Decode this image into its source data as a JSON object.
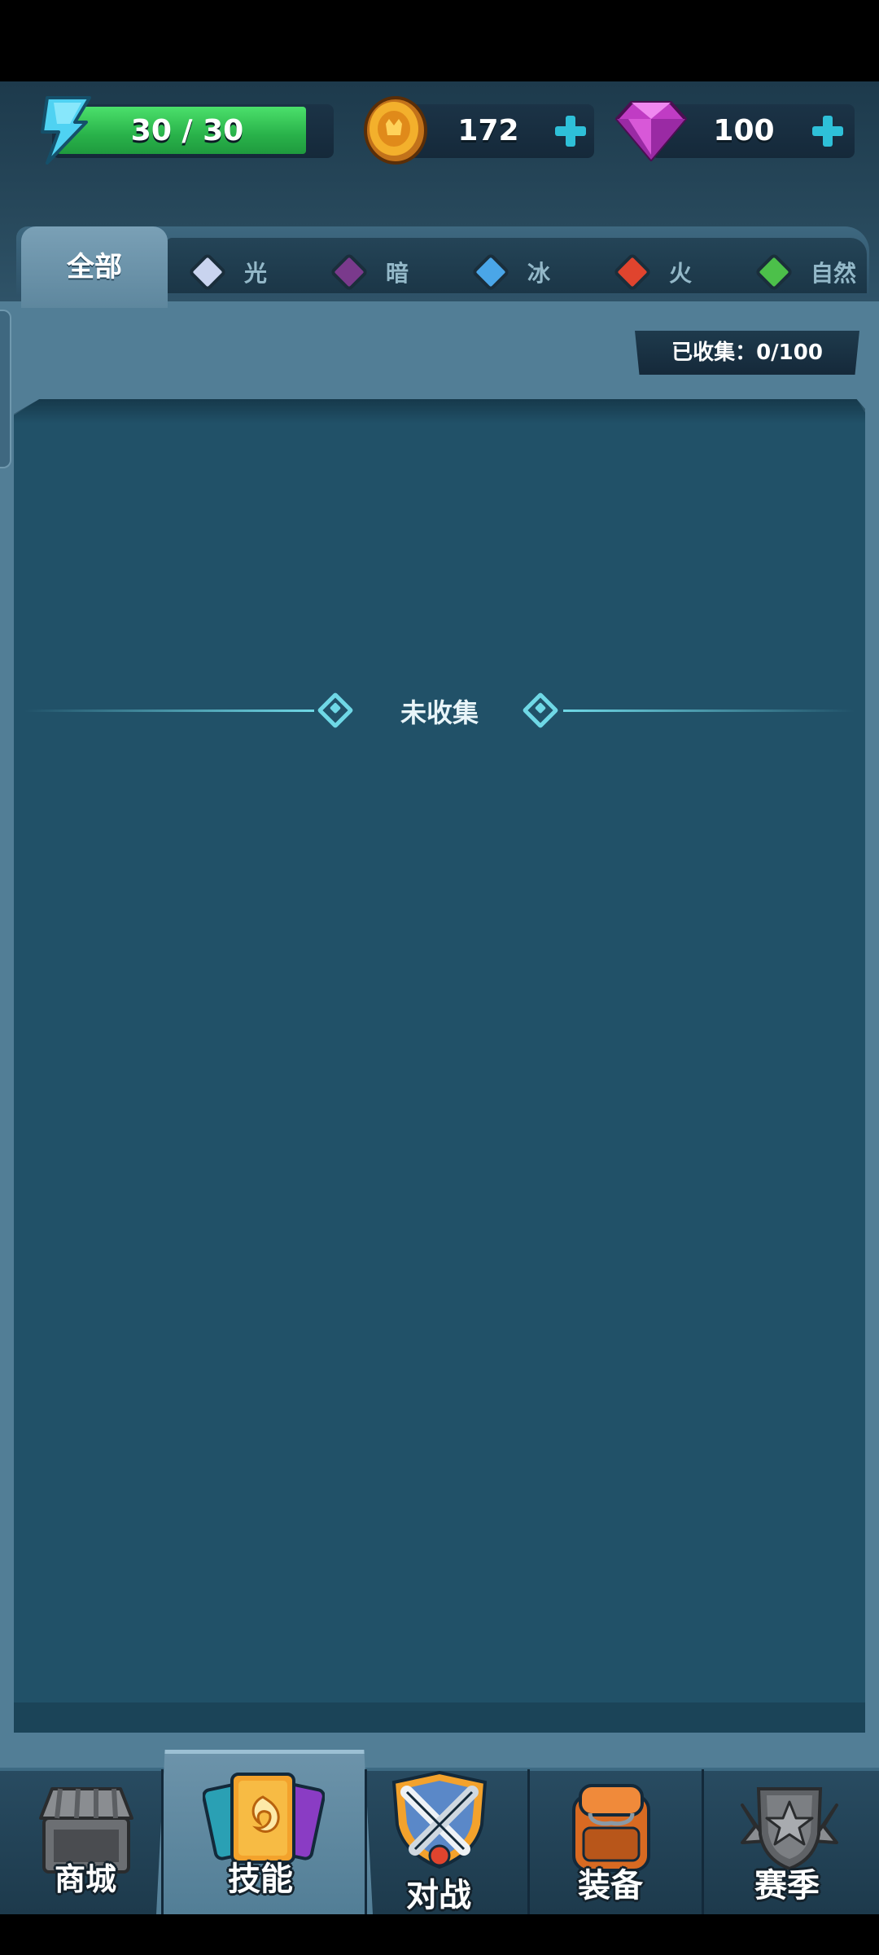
{
  "resources": {
    "energy": {
      "value": "30 / 30",
      "current": 30,
      "max": 30,
      "icon": "lightning-icon"
    },
    "coins": {
      "value": "172",
      "icon": "gold-coin-icon"
    },
    "gems": {
      "value": "100",
      "icon": "pink-gem-icon"
    }
  },
  "tabs": [
    {
      "label": "全部",
      "active": true
    },
    {
      "label": "光",
      "icon": "light-element-icon",
      "color": "#c9d4ef"
    },
    {
      "label": "暗",
      "icon": "dark-element-icon",
      "color": "#7a3a8c"
    },
    {
      "label": "冰",
      "icon": "ice-element-icon",
      "color": "#4aa6e8"
    },
    {
      "label": "火",
      "icon": "fire-element-icon",
      "color": "#e0442e"
    },
    {
      "label": "自然",
      "icon": "nature-element-icon",
      "color": "#4cc04a"
    }
  ],
  "collection": {
    "counter": "已收集：0/100",
    "section_label": "未收集"
  },
  "bottom_nav": [
    {
      "label": "商城",
      "icon": "shop-icon",
      "active": false
    },
    {
      "label": "技能",
      "icon": "skill-card-icon",
      "active": true
    },
    {
      "label": "对战",
      "icon": "battle-shield-icon",
      "active": false
    },
    {
      "label": "装备",
      "icon": "backpack-icon",
      "active": false
    },
    {
      "label": "赛季",
      "icon": "season-badge-icon",
      "active": false
    }
  ],
  "colors": {
    "panel": "#527e96",
    "content_bg": "#215168",
    "accent_cyan": "#6fd8e6",
    "energy_green": "#2fbf50"
  }
}
